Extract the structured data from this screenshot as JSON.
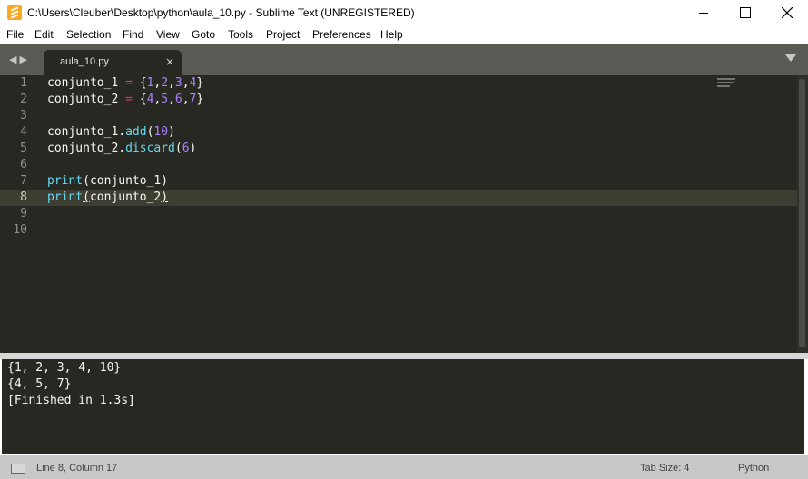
{
  "window": {
    "title": "C:\\Users\\Cleuber\\Desktop\\python\\aula_10.py - Sublime Text (UNREGISTERED)"
  },
  "menu": [
    "File",
    "Edit",
    "Selection",
    "Find",
    "View",
    "Goto",
    "Tools",
    "Project",
    "Preferences",
    "Help"
  ],
  "tab": {
    "label": "aula_10.py",
    "close": "×"
  },
  "editor": {
    "current_line": 8,
    "lines": [
      {
        "n": "1"
      },
      {
        "n": "2"
      },
      {
        "n": "3"
      },
      {
        "n": "4"
      },
      {
        "n": "5"
      },
      {
        "n": "6"
      },
      {
        "n": "7"
      },
      {
        "n": "8"
      },
      {
        "n": "9"
      },
      {
        "n": "10"
      }
    ]
  },
  "output": [
    "{1, 2, 3, 4, 10}",
    "{4, 5, 7}",
    "[Finished in 1.3s]"
  ],
  "status": {
    "position": "Line 8, Column 17",
    "tab_size": "Tab Size: 4",
    "syntax": "Python"
  },
  "colors": {
    "editor_bg": "#272822",
    "keyword": "#f92672",
    "number": "#ae81ff",
    "function": "#66d9ef"
  }
}
